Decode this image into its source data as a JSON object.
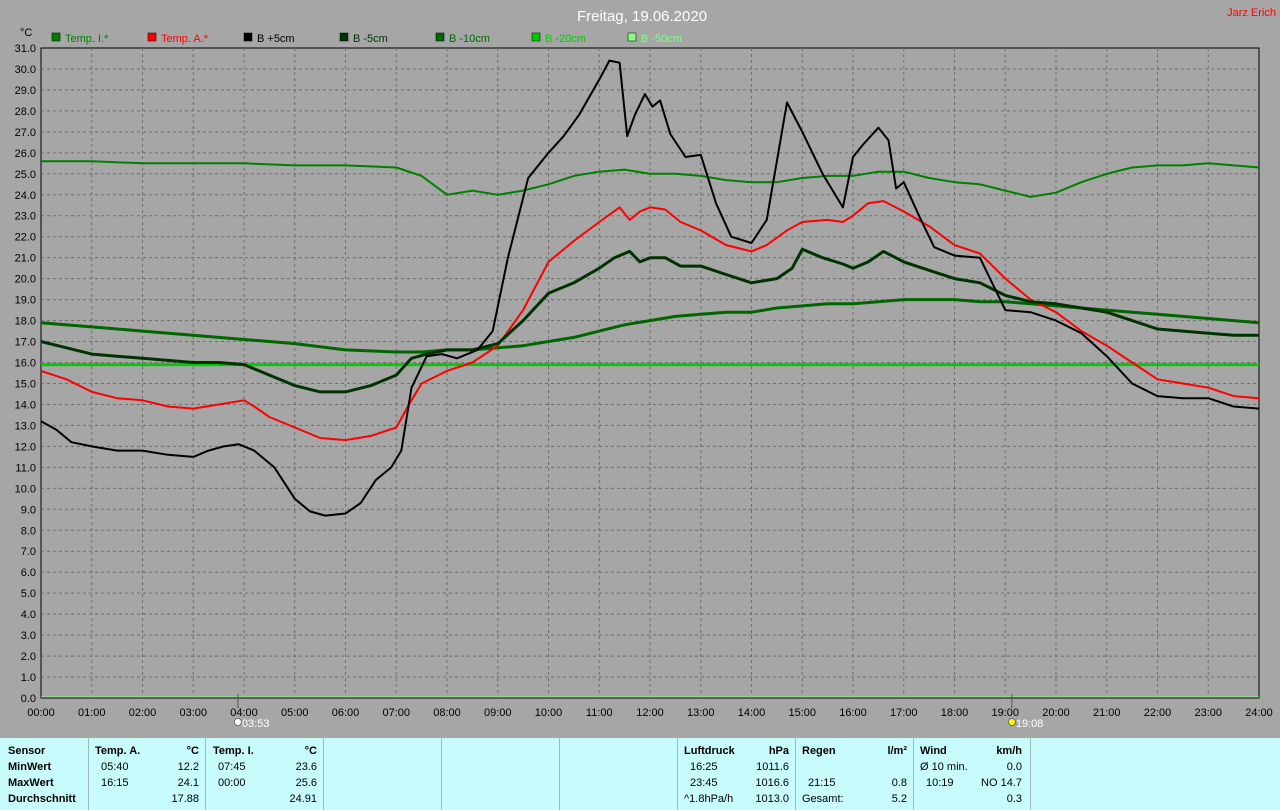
{
  "header": {
    "title": "Freitag, 19.06.2020",
    "author": "Jarz Erich",
    "unit": "°C"
  },
  "legend": [
    {
      "label": "Temp. I.*",
      "color": "#008000"
    },
    {
      "label": "Temp. A.*",
      "color": "#ff0000"
    },
    {
      "label": "B +5cm",
      "color": "#000000"
    },
    {
      "label": "B -5cm",
      "color": "#003300"
    },
    {
      "label": "B -10cm",
      "color": "#006600"
    },
    {
      "label": "B -20cm",
      "color": "#00cc00"
    },
    {
      "label": "B -50cm",
      "color": "#80ff80"
    }
  ],
  "chart_data": {
    "type": "line",
    "title": "Freitag, 19.06.2020",
    "ylabel": "°C",
    "ylim": [
      0,
      31
    ],
    "yticks": [
      "0.0",
      "1.0",
      "2.0",
      "3.0",
      "4.0",
      "5.0",
      "6.0",
      "7.0",
      "8.0",
      "9.0",
      "10.0",
      "11.0",
      "12.0",
      "13.0",
      "14.0",
      "15.0",
      "16.0",
      "17.0",
      "18.0",
      "19.0",
      "20.0",
      "21.0",
      "22.0",
      "23.0",
      "24.0",
      "25.0",
      "26.0",
      "27.0",
      "28.0",
      "29.0",
      "30.0",
      "31.0"
    ],
    "xlim": [
      0,
      24
    ],
    "xticks": [
      "00:00",
      "01:00",
      "02:00",
      "03:00",
      "04:00",
      "05:00",
      "06:00",
      "07:00",
      "08:00",
      "09:00",
      "10:00",
      "11:00",
      "12:00",
      "13:00",
      "14:00",
      "15:00",
      "16:00",
      "17:00",
      "18:00",
      "19:00",
      "20:00",
      "21:00",
      "22:00",
      "23:00",
      "24:00"
    ],
    "grid": true,
    "sun_markers": [
      {
        "label": "03:53",
        "x": 3.88
      },
      {
        "label": "19:08",
        "x": 19.13
      }
    ],
    "series": [
      {
        "name": "Temp. I.*",
        "color": "#008000",
        "width": 2,
        "x": [
          0,
          1,
          2,
          3,
          4,
          5,
          6,
          7,
          7.5,
          8,
          8.5,
          9,
          9.5,
          10,
          10.5,
          11,
          11.5,
          12,
          12.5,
          13,
          13.5,
          14,
          14.5,
          15,
          15.5,
          16,
          16.5,
          17,
          17.5,
          18,
          18.5,
          19,
          19.5,
          20,
          20.5,
          21,
          21.5,
          22,
          22.5,
          23,
          23.5,
          24
        ],
        "y": [
          25.6,
          25.6,
          25.5,
          25.5,
          25.5,
          25.4,
          25.4,
          25.3,
          24.9,
          24.0,
          24.2,
          24.0,
          24.2,
          24.5,
          24.9,
          25.1,
          25.2,
          25.0,
          25.0,
          24.9,
          24.7,
          24.6,
          24.6,
          24.8,
          24.9,
          24.9,
          25.1,
          25.1,
          24.8,
          24.6,
          24.5,
          24.2,
          23.9,
          24.1,
          24.6,
          25.0,
          25.3,
          25.4,
          25.4,
          25.5,
          25.4,
          25.3
        ]
      },
      {
        "name": "Temp. A.*",
        "color": "#ff0000",
        "width": 2,
        "x": [
          0,
          0.5,
          1,
          1.5,
          2,
          2.5,
          3,
          3.5,
          4,
          4.2,
          4.5,
          5,
          5.5,
          6,
          6.5,
          7,
          7.3,
          7.5,
          8,
          8.5,
          9,
          9.5,
          10,
          10.5,
          11,
          11.4,
          11.6,
          11.8,
          12,
          12.3,
          12.6,
          13,
          13.5,
          14,
          14.3,
          14.7,
          15,
          15.5,
          15.8,
          16,
          16.3,
          16.6,
          17,
          17.5,
          18,
          18.5,
          19,
          19.5,
          20,
          20.5,
          21,
          21.5,
          22,
          22.5,
          23,
          23.5,
          24
        ],
        "y": [
          15.6,
          15.2,
          14.6,
          14.3,
          14.2,
          13.9,
          13.8,
          14.0,
          14.2,
          13.9,
          13.4,
          12.9,
          12.4,
          12.3,
          12.5,
          12.9,
          14.2,
          15.0,
          15.6,
          16.0,
          16.8,
          18.5,
          20.8,
          21.8,
          22.7,
          23.4,
          22.8,
          23.2,
          23.4,
          23.3,
          22.7,
          22.3,
          21.6,
          21.3,
          21.6,
          22.3,
          22.7,
          22.8,
          22.7,
          23.0,
          23.6,
          23.7,
          23.2,
          22.5,
          21.6,
          21.2,
          20.0,
          19.0,
          18.4,
          17.5,
          16.8,
          16.0,
          15.2,
          15.0,
          14.8,
          14.4,
          14.3
        ]
      },
      {
        "name": "B +5cm",
        "color": "#000000",
        "width": 2,
        "x": [
          0,
          0.3,
          0.6,
          1,
          1.5,
          2,
          2.5,
          3,
          3.3,
          3.6,
          3.9,
          4.2,
          4.6,
          5,
          5.3,
          5.6,
          6,
          6.3,
          6.6,
          6.9,
          7.1,
          7.3,
          7.6,
          7.9,
          8.2,
          8.6,
          8.9,
          9.2,
          9.6,
          10,
          10.3,
          10.6,
          11,
          11.2,
          11.4,
          11.55,
          11.7,
          11.9,
          12.05,
          12.2,
          12.4,
          12.7,
          13,
          13.3,
          13.6,
          14,
          14.3,
          14.7,
          15,
          15.4,
          15.8,
          16,
          16.2,
          16.5,
          16.7,
          16.85,
          17,
          17.3,
          17.6,
          18,
          18.5,
          19,
          19.5,
          20,
          20.5,
          21,
          21.5,
          22,
          22.5,
          23,
          23.5,
          24
        ],
        "y": [
          13.2,
          12.8,
          12.2,
          12.0,
          11.8,
          11.8,
          11.6,
          11.5,
          11.8,
          12.0,
          12.1,
          11.8,
          11.0,
          9.5,
          8.9,
          8.7,
          8.8,
          9.3,
          10.4,
          11.0,
          11.8,
          14.8,
          16.3,
          16.4,
          16.2,
          16.6,
          17.5,
          21.0,
          24.8,
          26.0,
          26.8,
          27.8,
          29.5,
          30.4,
          30.3,
          26.8,
          27.8,
          28.8,
          28.2,
          28.5,
          26.9,
          25.8,
          25.9,
          23.6,
          22.0,
          21.7,
          22.8,
          28.4,
          27.0,
          25.0,
          23.4,
          25.8,
          26.4,
          27.2,
          26.6,
          24.3,
          24.6,
          23.0,
          21.5,
          21.1,
          21.0,
          18.5,
          18.4,
          18.0,
          17.4,
          16.3,
          15.0,
          14.4,
          14.3,
          14.3,
          13.9,
          13.8
        ]
      },
      {
        "name": "B -5cm",
        "color": "#003300",
        "width": 3,
        "x": [
          0,
          0.5,
          1,
          1.5,
          2,
          2.5,
          3,
          3.5,
          4,
          4.5,
          5,
          5.5,
          6,
          6.5,
          7,
          7.3,
          7.6,
          8,
          8.5,
          9,
          9.5,
          10,
          10.5,
          11,
          11.3,
          11.6,
          11.8,
          12,
          12.3,
          12.6,
          13,
          13.5,
          14,
          14.5,
          14.8,
          15,
          15.4,
          15.8,
          16,
          16.3,
          16.6,
          17,
          17.5,
          18,
          18.5,
          19,
          19.5,
          20,
          20.5,
          21,
          21.5,
          22,
          22.5,
          23,
          23.5,
          24
        ],
        "y": [
          17.0,
          16.7,
          16.4,
          16.3,
          16.2,
          16.1,
          16.0,
          16.0,
          15.9,
          15.4,
          14.9,
          14.6,
          14.6,
          14.9,
          15.4,
          16.2,
          16.4,
          16.6,
          16.6,
          16.9,
          18.0,
          19.3,
          19.8,
          20.5,
          21.0,
          21.3,
          20.8,
          21.0,
          21.0,
          20.6,
          20.6,
          20.2,
          19.8,
          20.0,
          20.5,
          21.4,
          21.0,
          20.7,
          20.5,
          20.8,
          21.3,
          20.8,
          20.4,
          20.0,
          19.8,
          19.2,
          18.9,
          18.8,
          18.6,
          18.4,
          18.0,
          17.6,
          17.5,
          17.4,
          17.3,
          17.3
        ]
      },
      {
        "name": "B -10cm",
        "color": "#006600",
        "width": 3,
        "x": [
          0,
          1,
          2,
          3,
          4,
          5,
          6,
          7,
          7.5,
          8,
          8.5,
          9,
          9.5,
          10,
          10.5,
          11,
          11.5,
          12,
          12.5,
          13,
          13.5,
          14,
          14.5,
          15,
          15.5,
          16,
          16.5,
          17,
          17.5,
          18,
          18.5,
          19,
          19.5,
          20,
          20.5,
          21,
          21.5,
          22,
          22.5,
          23,
          23.5,
          24
        ],
        "y": [
          17.9,
          17.7,
          17.5,
          17.3,
          17.1,
          16.9,
          16.6,
          16.5,
          16.5,
          16.6,
          16.6,
          16.7,
          16.8,
          17.0,
          17.2,
          17.5,
          17.8,
          18.0,
          18.2,
          18.3,
          18.4,
          18.4,
          18.6,
          18.7,
          18.8,
          18.8,
          18.9,
          19.0,
          19.0,
          19.0,
          18.9,
          18.9,
          18.8,
          18.7,
          18.6,
          18.5,
          18.4,
          18.3,
          18.2,
          18.1,
          18.0,
          17.9
        ]
      },
      {
        "name": "B -20cm",
        "color": "#00cc00",
        "width": 3,
        "x": [
          0,
          2,
          4,
          5,
          6,
          7,
          8,
          9,
          10,
          11,
          12,
          13,
          14,
          15,
          16,
          17,
          18,
          19,
          20,
          21,
          22,
          23,
          24
        ],
        "y": [
          15.9,
          15.9,
          15.9,
          15.9,
          15.9,
          15.9,
          15.9,
          15.9,
          15.9,
          15.9,
          15.9,
          15.9,
          15.9,
          15.9,
          15.9,
          15.9,
          15.9,
          15.9,
          15.9,
          15.9,
          15.9,
          15.9,
          15.9
        ]
      },
      {
        "name": "B -50cm",
        "color": "#80ff80",
        "width": 1,
        "x": [
          0,
          24
        ],
        "y": [
          0.05,
          0.05
        ]
      }
    ]
  },
  "stats": {
    "sensor": {
      "title": "Sensor",
      "min": "MinWert",
      "max": "MaxWert",
      "avg": "Durchschnitt"
    },
    "temp_a": {
      "title": "Temp. A.",
      "unit": "°C",
      "min_time": "05:40",
      "min_val": "12.2",
      "max_time": "16:15",
      "max_val": "24.1",
      "avg": "17.88"
    },
    "temp_i": {
      "title": "Temp. I.",
      "unit": "°C",
      "min_time": "07:45",
      "min_val": "23.6",
      "max_time": "00:00",
      "max_val": "25.6",
      "avg": "24.91"
    },
    "pressure": {
      "title": "Luftdruck",
      "unit": "hPa",
      "min_time": "16:25",
      "min_val": "1011.6",
      "max_time": "23:45",
      "max_val": "1016.6",
      "trend": "^1.8hPa/h",
      "trend_val": "1013.0"
    },
    "rain": {
      "title": "Regen",
      "unit": "l/m²",
      "max_time": "21:15",
      "max_val": "0.8",
      "total_label": "Gesamt:",
      "total_val": "5.2"
    },
    "wind": {
      "title": "Wind",
      "unit": "km/h",
      "avg_label": "Ø 10 min.",
      "avg_val": "0.0",
      "max_time": "10:19",
      "max_val": "NO 14.7",
      "last_val": "0.3"
    }
  }
}
